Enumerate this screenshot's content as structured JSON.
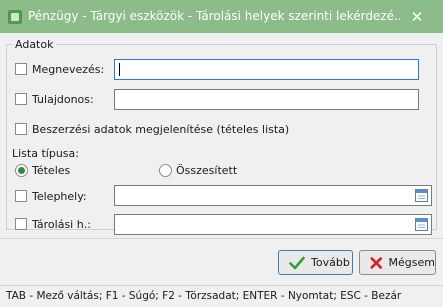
{
  "window": {
    "title": "Pénzügy - Tárgyi eszközök - Tárolási helyek szerinti lekérdezé...",
    "close_glyph": "✕",
    "titlebar_color": "#8cbc8a"
  },
  "form": {
    "group_title": "Adatok",
    "megnevezes": {
      "label": "Megnevezés:",
      "value": ""
    },
    "tulajdonos": {
      "label": "Tulajdonos:",
      "value": ""
    },
    "beszerzesi": {
      "label": "Beszerzési adatok megjelenítése (tételes lista)"
    },
    "lista_tipusa": {
      "label": "Lista típusa:",
      "options": [
        "Tételes",
        "Összesített"
      ],
      "selected": "Tételes"
    },
    "telephely": {
      "label": "Telephely:",
      "value": ""
    },
    "tarolasi_h": {
      "label": "Tárolási h.:",
      "value": ""
    }
  },
  "buttons": {
    "tovabb": "Tovább",
    "megsem": "Mégsem"
  },
  "icons": {
    "app": "green-square-icon",
    "check": "check-icon",
    "cancel": "x-icon",
    "calendar": "calendar-icon"
  },
  "status_bar": "TAB - Mező váltás; F1 - Súgó; F2 - Törzsadat; ENTER - Nyomtat; ESC - Bezár"
}
